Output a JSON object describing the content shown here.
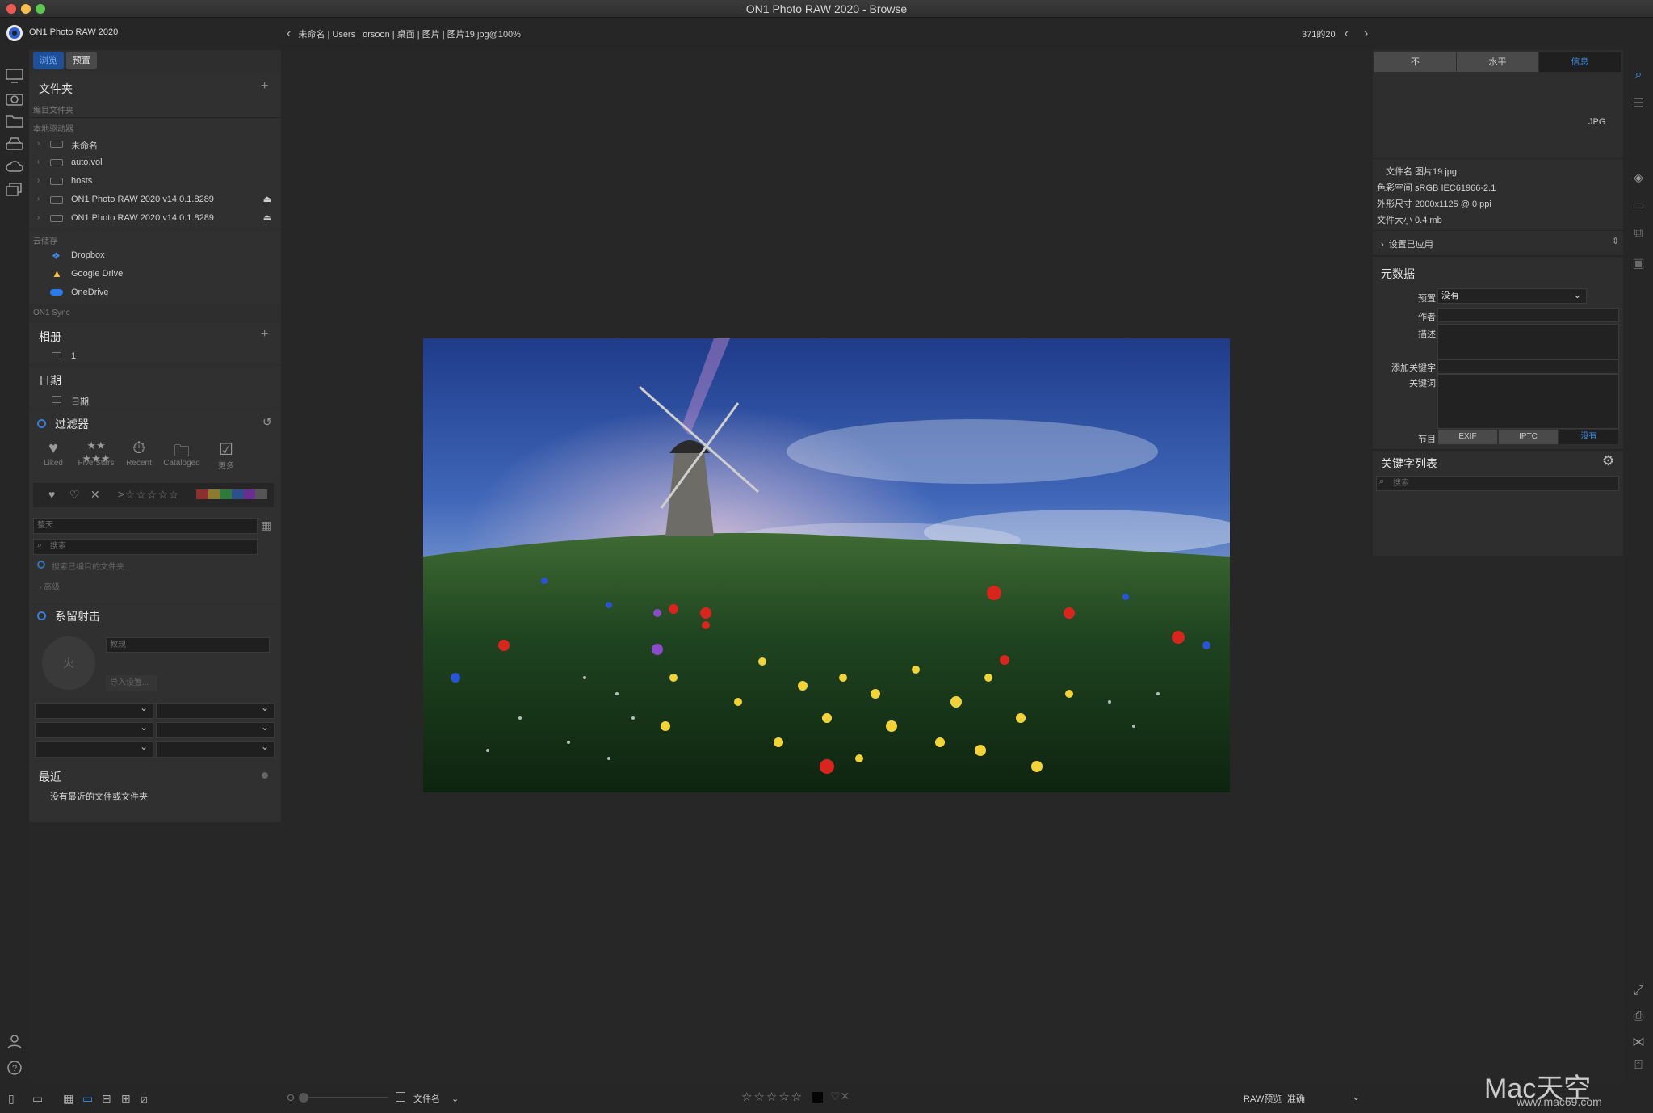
{
  "window": {
    "title": "ON1 Photo RAW 2020 - Browse"
  },
  "app": {
    "name": "ON1 Photo RAW 2020"
  },
  "breadcrumb": {
    "parts": [
      "未命名",
      "Users",
      "orsoon",
      "桌面",
      "图片",
      "图片19.jpg@100%"
    ]
  },
  "pager": {
    "text": "371的20"
  },
  "left": {
    "tabs": [
      "浏览",
      "预置"
    ],
    "folders": {
      "title": "文件夹",
      "catalog_label": "编目文件夹",
      "local_label": "本地驱动器",
      "drives": [
        "未命名",
        "auto.vol",
        "hosts",
        "ON1 Photo RAW 2020 v14.0.1.8289",
        "ON1 Photo RAW 2020 v14.0.1.8289"
      ],
      "cloud_label": "云储存",
      "cloud": [
        "Dropbox",
        "Google Drive",
        "OneDrive"
      ],
      "sync_label": "ON1 Sync"
    },
    "albums": {
      "title": "相册",
      "items": [
        "1"
      ]
    },
    "dates": {
      "title": "日期",
      "items": [
        "日期"
      ]
    },
    "filters": {
      "title": "过滤器",
      "icons": [
        "Liked",
        "Five Stars",
        "Recent",
        "Cataloged",
        "更多"
      ],
      "date_placeholder": "整天",
      "search_placeholder": "搜索",
      "search_cataloged": "搜索已编目的文件夹",
      "advanced": "高级"
    },
    "tether": {
      "title": "系留射击",
      "camera_field": "教规",
      "button_circle": "火",
      "import_button": "导入设置..."
    },
    "recent": {
      "title": "最近",
      "empty": "没有最近的文件或文件夹"
    }
  },
  "right": {
    "segments": [
      "不",
      "水平",
      "信息"
    ],
    "format": "JPG",
    "info": {
      "filename": "文件名 图片19.jpg",
      "colorspace": "色彩空间 sRGB IEC61966-2.1",
      "dimensions": "外形尺寸 2000x1125 @ 0 ppi",
      "filesize": "文件大小 0.4 mb"
    },
    "settings_applied": "设置已应用",
    "metadata": {
      "title": "元数据",
      "preset_label": "预置",
      "preset_value": "没有",
      "author_label": "作者",
      "desc_label": "描述",
      "add_kw_label": "添加关键字",
      "kw_label": "关键词",
      "section_label": "节目",
      "section_tabs": [
        "EXIF",
        "IPTC",
        "没有"
      ]
    },
    "keywords": {
      "title": "关键字列表",
      "search_placeholder": "搜索"
    }
  },
  "bottom": {
    "sort_label": "文件名",
    "raw_label": "RAW预览",
    "raw_value": "准确"
  },
  "watermark": {
    "brand": "Mac天空",
    "url": "www.mac69.com"
  },
  "colors": {
    "accent": "#3a7bd5",
    "panel": "#2e2e2e",
    "background": "#272727"
  }
}
